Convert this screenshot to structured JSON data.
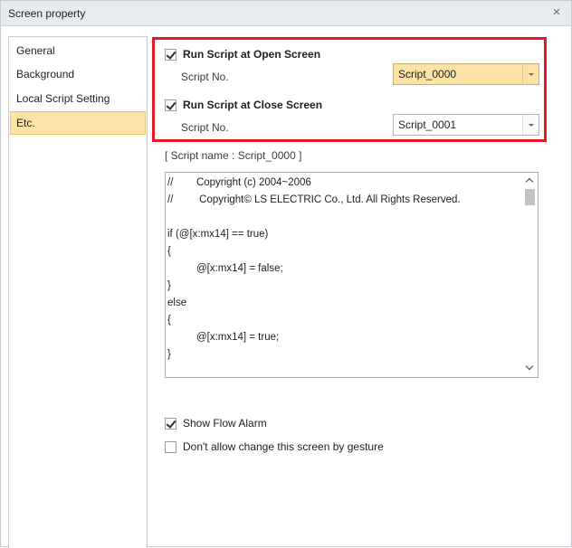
{
  "window": {
    "title": "Screen property",
    "close_glyph": "×"
  },
  "nav": {
    "items": [
      {
        "label": "General"
      },
      {
        "label": "Background"
      },
      {
        "label": "Local Script Setting"
      },
      {
        "label": "Etc."
      }
    ],
    "selected": "Etc."
  },
  "open_screen": {
    "checkbox_label": "Run Script at Open Screen",
    "checked": true,
    "field_label": "Script No.",
    "value": "Script_0000"
  },
  "close_screen": {
    "checkbox_label": "Run Script at Close Screen",
    "checked": true,
    "field_label": "Script No.",
    "value": "Script_0001"
  },
  "script_name": "[ Script name : Script_0000 ]",
  "code_lines": [
    "//        Copyright (c) 2004~2006",
    "//         Copyright© LS ELECTRIC Co., Ltd. All Rights Reserved.",
    "",
    "if (@[x:mx14] == true)",
    "{",
    "          @[x:mx14] = false;",
    "}",
    "else",
    "{",
    "          @[x:mx14] = true;",
    "}"
  ],
  "options": {
    "show_flow_alarm": {
      "label": "Show Flow Alarm",
      "checked": true
    },
    "no_gesture": {
      "label": "Don't allow change this screen by gesture",
      "checked": false
    }
  },
  "colors": {
    "highlight_border": "#e41b23",
    "selection": "#fbe3a6",
    "titlebar": "#e7ebf0"
  }
}
